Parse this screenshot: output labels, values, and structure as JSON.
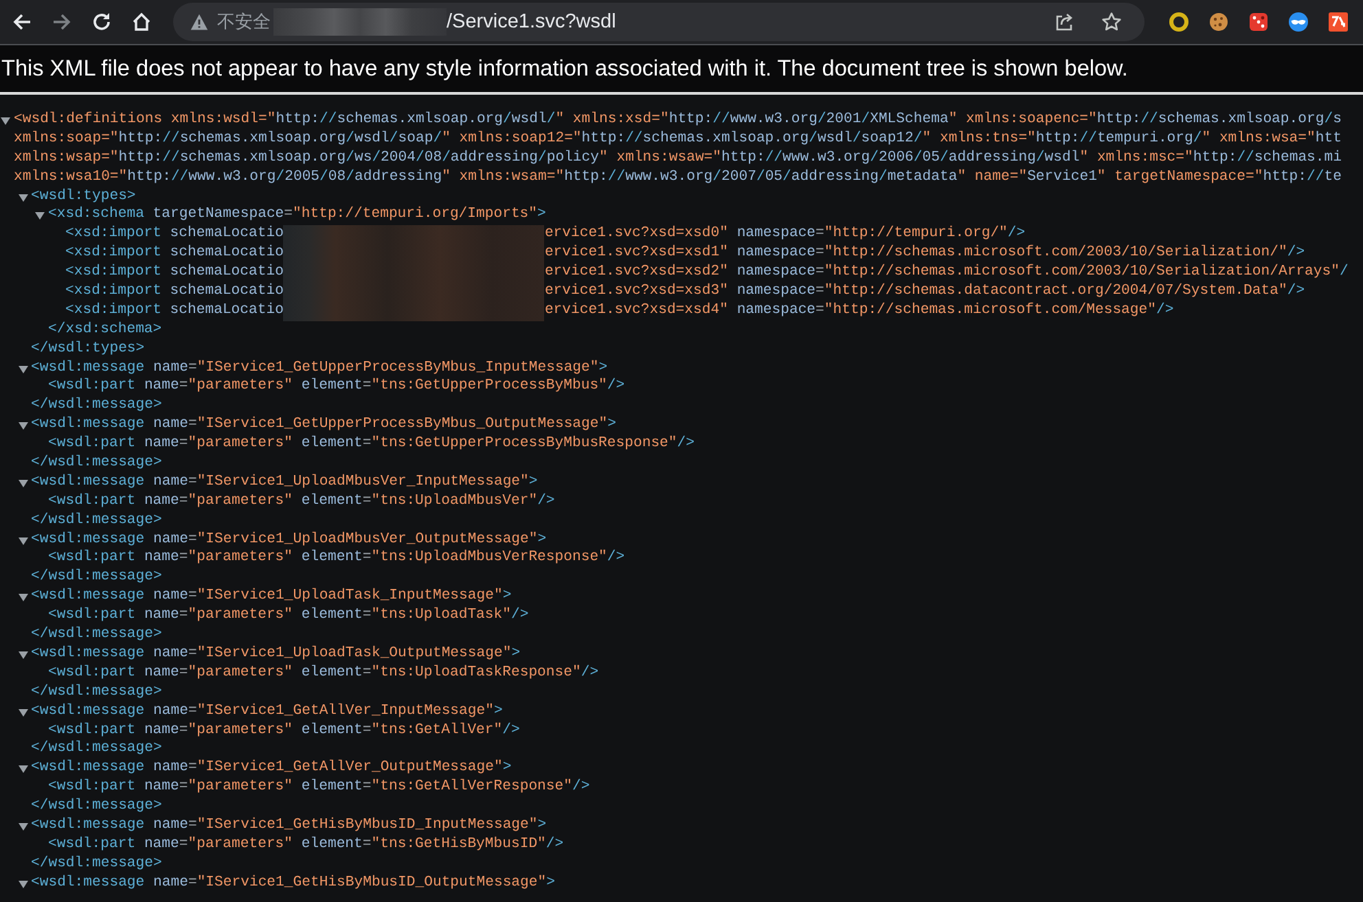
{
  "navigation": [
    {
      "kind": "back",
      "disabled": false
    },
    {
      "kind": "forward",
      "disabled": true
    },
    {
      "kind": "reload",
      "disabled": false
    },
    {
      "kind": "home",
      "disabled": false
    }
  ],
  "address_bar": {
    "security_label": "不安全",
    "url": "/Service1.svc?wsdl",
    "bookmarked": false
  },
  "extensions": [
    {
      "kind": "ring"
    },
    {
      "kind": "cookie"
    },
    {
      "kind": "dice"
    },
    {
      "kind": "mask"
    },
    {
      "kind": "translate"
    }
  ],
  "banner": "This XML file does not appear to have any style information associated with it. The document tree is shown below.",
  "xml_tree": {
    "expanded": true,
    "open": [
      "<wsdl:definitions xmlns:wsdl=\"http://schemas.xmlsoap.org/wsdl/\" xmlns:xsd=\"http://www.w3.org/2001/XMLSchema\" xmlns:soapenc=\"http://schemas.xmlsoap.org/s",
      "xmlns:soap=\"http://schemas.xmlsoap.org/wsdl/soap/\" xmlns:soap12=\"http://schemas.xmlsoap.org/wsdl/soap12/\" xmlns:tns=\"http://tempuri.org/\" xmlns:wsa=\"htt",
      "xmlns:wsap=\"http://schemas.xmlsoap.org/ws/2004/08/addressing/policy\" xmlns:wsaw=\"http://www.w3.org/2006/05/addressing/wsdl\" xmlns:msc=\"http://schemas.mi",
      "xmlns:wsa10=\"http://www.w3.org/2005/08/addressing\" xmlns:wsam=\"http://www.w3.org/2007/05/addressing/metadata\" name=\"Service1\" targetNamespace=\"http://te"
    ],
    "children": [
      {
        "expanded": true,
        "open": [
          "<wsdl:types>"
        ],
        "close": "</wsdl:types>",
        "children": [
          {
            "expanded": true,
            "open": [
              "<xsd:schema targetNamespace=\"http://tempuri.org/Imports\">"
            ],
            "close": "</xsd:schema>",
            "children": [
              {
                "open": [
                  [
                    "<xsd:import schemaLocatio",
                    "ervice1.svc?xsd=xsd0\" namespace=\"http://tempuri.org/\"/>"
                  ]
                ]
              },
              {
                "open": [
                  [
                    "<xsd:import schemaLocatio",
                    "ervice1.svc?xsd=xsd1\" namespace=\"http://schemas.microsoft.com/2003/10/Serialization/\"/>"
                  ]
                ]
              },
              {
                "open": [
                  [
                    "<xsd:import schemaLocatio",
                    "ervice1.svc?xsd=xsd2\" namespace=\"http://schemas.microsoft.com/2003/10/Serialization/Arrays\"/"
                  ]
                ]
              },
              {
                "open": [
                  [
                    "<xsd:import schemaLocatio",
                    "ervice1.svc?xsd=xsd3\" namespace=\"http://schemas.datacontract.org/2004/07/System.Data\"/>"
                  ]
                ]
              },
              {
                "open": [
                  [
                    "<xsd:import schemaLocatio",
                    "ervice1.svc?xsd=xsd4\" namespace=\"http://schemas.microsoft.com/Message\"/>"
                  ]
                ]
              }
            ]
          }
        ]
      },
      {
        "expanded": true,
        "open": [
          "<wsdl:message name=\"IService1_GetUpperProcessByMbus_InputMessage\">"
        ],
        "close": "</wsdl:message>",
        "children": [
          {
            "open": [
              "<wsdl:part name=\"parameters\" element=\"tns:GetUpperProcessByMbus\"/>"
            ]
          }
        ]
      },
      {
        "expanded": true,
        "open": [
          "<wsdl:message name=\"IService1_GetUpperProcessByMbus_OutputMessage\">"
        ],
        "close": "</wsdl:message>",
        "children": [
          {
            "open": [
              "<wsdl:part name=\"parameters\" element=\"tns:GetUpperProcessByMbusResponse\"/>"
            ]
          }
        ]
      },
      {
        "expanded": true,
        "open": [
          "<wsdl:message name=\"IService1_UploadMbusVer_InputMessage\">"
        ],
        "close": "</wsdl:message>",
        "children": [
          {
            "open": [
              "<wsdl:part name=\"parameters\" element=\"tns:UploadMbusVer\"/>"
            ]
          }
        ]
      },
      {
        "expanded": true,
        "open": [
          "<wsdl:message name=\"IService1_UploadMbusVer_OutputMessage\">"
        ],
        "close": "</wsdl:message>",
        "children": [
          {
            "open": [
              "<wsdl:part name=\"parameters\" element=\"tns:UploadMbusVerResponse\"/>"
            ]
          }
        ]
      },
      {
        "expanded": true,
        "open": [
          "<wsdl:message name=\"IService1_UploadTask_InputMessage\">"
        ],
        "close": "</wsdl:message>",
        "children": [
          {
            "open": [
              "<wsdl:part name=\"parameters\" element=\"tns:UploadTask\"/>"
            ]
          }
        ]
      },
      {
        "expanded": true,
        "open": [
          "<wsdl:message name=\"IService1_UploadTask_OutputMessage\">"
        ],
        "close": "</wsdl:message>",
        "children": [
          {
            "open": [
              "<wsdl:part name=\"parameters\" element=\"tns:UploadTaskResponse\"/>"
            ]
          }
        ]
      },
      {
        "expanded": true,
        "open": [
          "<wsdl:message name=\"IService1_GetAllVer_InputMessage\">"
        ],
        "close": "</wsdl:message>",
        "children": [
          {
            "open": [
              "<wsdl:part name=\"parameters\" element=\"tns:GetAllVer\"/>"
            ]
          }
        ]
      },
      {
        "expanded": true,
        "open": [
          "<wsdl:message name=\"IService1_GetAllVer_OutputMessage\">"
        ],
        "close": "</wsdl:message>",
        "children": [
          {
            "open": [
              "<wsdl:part name=\"parameters\" element=\"tns:GetAllVerResponse\"/>"
            ]
          }
        ]
      },
      {
        "expanded": true,
        "open": [
          "<wsdl:message name=\"IService1_GetHisByMbusID_InputMessage\">"
        ],
        "close": "</wsdl:message>",
        "children": [
          {
            "open": [
              "<wsdl:part name=\"parameters\" element=\"tns:GetHisByMbusID\"/>"
            ]
          }
        ]
      },
      {
        "expanded": true,
        "open": [
          "<wsdl:message name=\"IService1_GetHisByMbusID_OutputMessage\">"
        ]
      }
    ]
  }
}
